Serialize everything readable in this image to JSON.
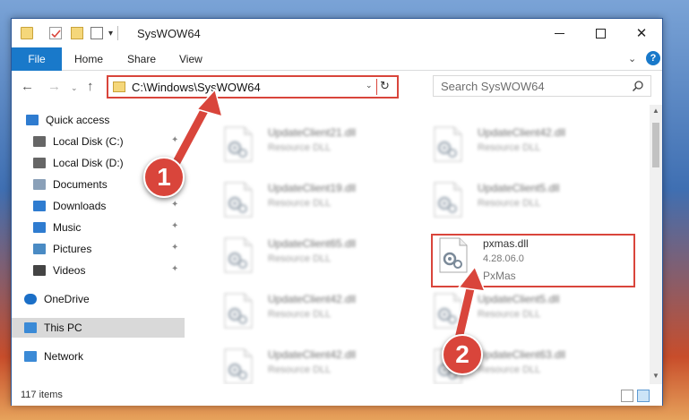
{
  "window": {
    "title": "SysWOW64",
    "controls": {
      "minimize": "—",
      "maximize": "☐",
      "close": "✕"
    }
  },
  "quick_access_toolbar": {
    "dropdown": "▾"
  },
  "ribbon": {
    "tabs": [
      "File",
      "Home",
      "Share",
      "View"
    ],
    "expand": "⌄",
    "help": "?"
  },
  "nav": {
    "back": "←",
    "forward": "→",
    "recent": "⌄",
    "up": "↑",
    "address": "C:\\Windows\\SysWOW64",
    "address_chevron": "⌄",
    "refresh": "↻",
    "search_placeholder": "Search SysWOW64"
  },
  "sidebar": {
    "items": [
      {
        "label": "Quick access",
        "icon": "star-icon",
        "pinned": false
      },
      {
        "label": "Local Disk (C:)",
        "icon": "drive-icon",
        "pinned": true
      },
      {
        "label": "Local Disk (D:)",
        "icon": "drive-icon",
        "pinned": false
      },
      {
        "label": "Documents",
        "icon": "documents-icon",
        "pinned": true
      },
      {
        "label": "Downloads",
        "icon": "downloads-icon",
        "pinned": true
      },
      {
        "label": "Music",
        "icon": "music-icon",
        "pinned": true
      },
      {
        "label": "Pictures",
        "icon": "pictures-icon",
        "pinned": true
      },
      {
        "label": "Videos",
        "icon": "videos-icon",
        "pinned": true
      },
      {
        "label": "OneDrive",
        "icon": "cloud-icon",
        "pinned": false
      },
      {
        "label": "This PC",
        "icon": "computer-icon",
        "pinned": false,
        "selected": true
      },
      {
        "label": "Network",
        "icon": "network-icon",
        "pinned": false
      }
    ],
    "pin_glyph": "📌"
  },
  "files": [
    {
      "name": "UpdateClient21.dll",
      "type": "Resource DLL"
    },
    {
      "name": "UpdateClient42.dll",
      "type": "Resource DLL"
    },
    {
      "name": "UpdateClient19.dll",
      "type": "Resource DLL"
    },
    {
      "name": "UpdateClient5.dll",
      "type": "Resource DLL"
    },
    {
      "name": "UpdateClient65.dll",
      "type": "Resource DLL"
    },
    {
      "name": "pxmas.dll",
      "version": "4.28.06.0",
      "type": "PxMas",
      "highlighted": true
    },
    {
      "name": "UpdateClient42.dll",
      "type": "Resource DLL"
    },
    {
      "name": "UpdateClient5.dll",
      "type": "Resource DLL"
    },
    {
      "name": "UpdateClient42.dll",
      "type": "Resource DLL"
    },
    {
      "name": "UpdateClient63.dll",
      "type": "Resource DLL"
    }
  ],
  "status": {
    "item_count": "117 items"
  },
  "annotations": {
    "step1": "1",
    "step2": "2",
    "accent": "#d9453b"
  }
}
